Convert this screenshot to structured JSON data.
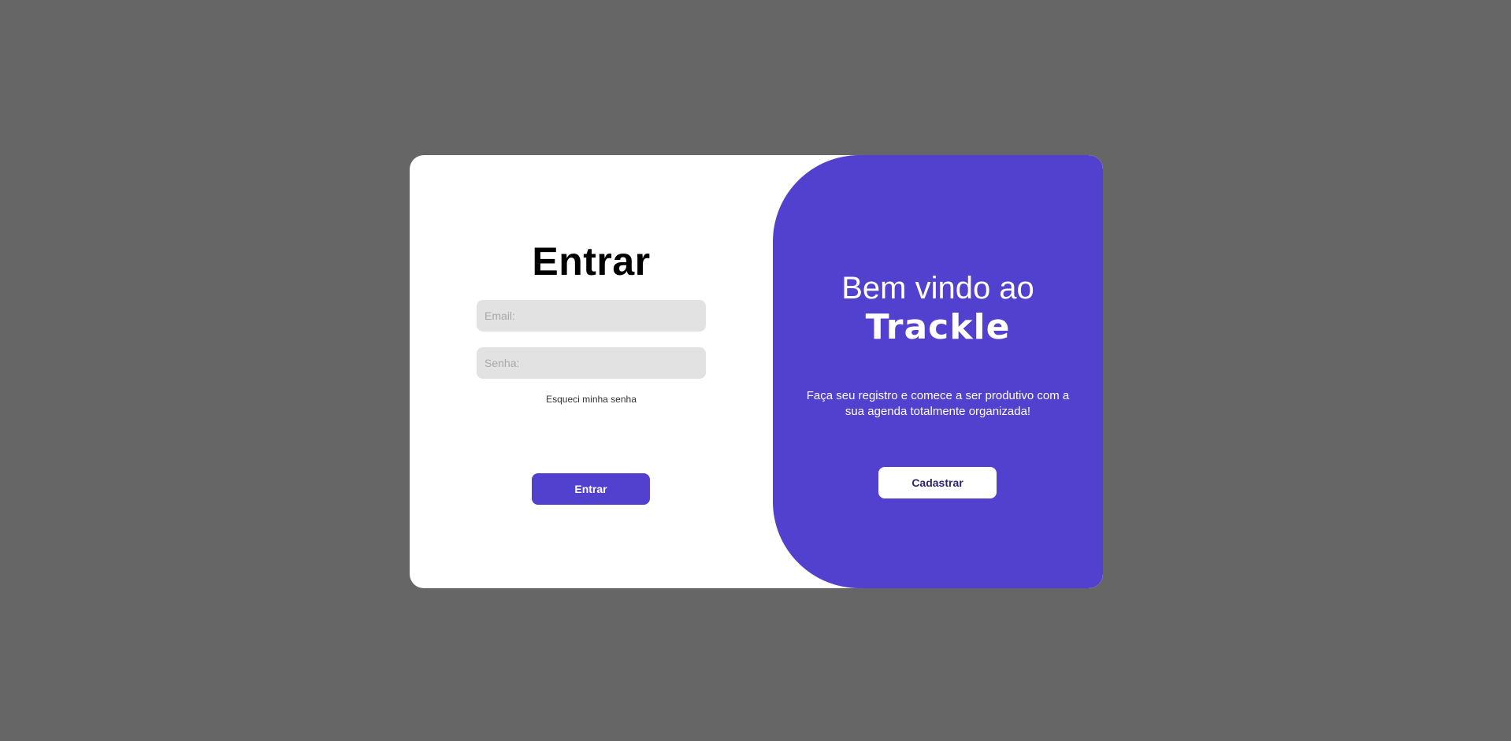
{
  "login": {
    "title": "Entrar",
    "email_placeholder": "Email:",
    "email_value": "",
    "password_placeholder": "Senha:",
    "password_value": "",
    "forgot_label": "Esqueci minha senha",
    "submit_label": "Entrar"
  },
  "welcome": {
    "title_line": "Bem vindo ao",
    "brand": "Trackle",
    "text": "Faça seu registro e comece a ser produtivo com a sua agenda totalmente organizada!",
    "signup_label": "Cadastrar"
  },
  "colors": {
    "accent": "#5240ce",
    "background": "#666666",
    "card": "#ffffff",
    "input": "#e2e2e2"
  }
}
